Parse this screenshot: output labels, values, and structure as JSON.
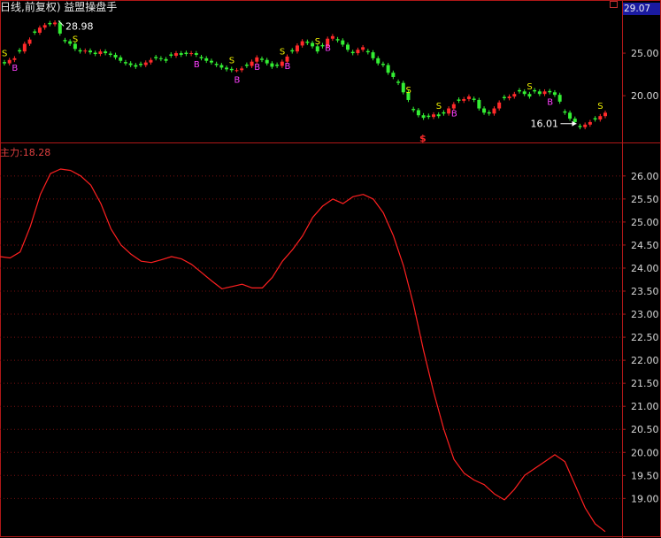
{
  "header": {
    "title": "日线,前复权) 益盟操盘手",
    "indicator_label": "主力:18.28",
    "last_price": "29.07"
  },
  "colors": {
    "background": "#000000",
    "frame": "#b01818",
    "grid": "#7a1010",
    "axis_text": "#d8d8d8",
    "indicator_line": "#ff2020",
    "candle_up": "#ff2a2a",
    "candle_down": "#33ee33",
    "signal_s": "#f0f000",
    "signal_b": "#ff40ff",
    "annotation": "#ffffff"
  },
  "chart_data": [
    {
      "type": "candlestick",
      "y_ticks": [
        "25.00",
        "20.00"
      ],
      "ylim": [
        14.5,
        30.0
      ],
      "annotations": {
        "high_label": "28.98",
        "low_label": "16.01",
        "marker_symbol": "$"
      },
      "closes": [
        23.8,
        24.2,
        24.4,
        25.2,
        26.1,
        26.6,
        27.4,
        28.0,
        28.3,
        28.4,
        28.6,
        27.3,
        26.4,
        26.1,
        25.5,
        25.2,
        25.3,
        25.1,
        24.9,
        25.2,
        25.0,
        24.8,
        24.5,
        24.1,
        23.8,
        23.6,
        23.4,
        23.6,
        23.9,
        24.2,
        24.4,
        24.3,
        24.1,
        24.7,
        25.0,
        24.8,
        24.9,
        25.0,
        24.8,
        24.4,
        24.1,
        23.9,
        23.6,
        23.3,
        23.1,
        23.0,
        23.0,
        23.2,
        23.5,
        24.0,
        24.5,
        24.2,
        23.8,
        23.4,
        23.5,
        24.0,
        24.6,
        25.2,
        25.9,
        26.4,
        26.2,
        25.8,
        25.2,
        25.8,
        26.7,
        27.0,
        26.5,
        26.0,
        25.4,
        25.0,
        25.4,
        25.7,
        25.1,
        24.4,
        23.8,
        23.6,
        22.7,
        22.2,
        21.5,
        20.4,
        19.5,
        18.3,
        17.7,
        17.4,
        17.5,
        17.8,
        17.6,
        17.9,
        18.5,
        19.0,
        19.4,
        19.6,
        19.9,
        19.5,
        18.5,
        18.0,
        17.9,
        18.5,
        19.2,
        19.7,
        19.9,
        20.2,
        20.5,
        20.2,
        19.9,
        20.5,
        20.2,
        20.5,
        20.4,
        20.1,
        19.3,
        18.0,
        17.3,
        16.9,
        16.3,
        16.6,
        16.9,
        17.2,
        17.6,
        18.0
      ]
    },
    {
      "type": "line",
      "name": "主力",
      "y_ticks": [
        "26.00",
        "25.50",
        "25.00",
        "24.50",
        "24.00",
        "23.50",
        "23.00",
        "22.50",
        "22.00",
        "21.50",
        "21.00",
        "20.50",
        "20.00",
        "19.50",
        "19.00"
      ],
      "ylim": [
        18.2,
        26.4
      ],
      "last_value": 18.28,
      "values": [
        24.25,
        24.22,
        24.35,
        24.9,
        25.6,
        26.05,
        26.15,
        26.12,
        26.0,
        25.8,
        25.4,
        24.85,
        24.5,
        24.3,
        24.15,
        24.12,
        24.18,
        24.25,
        24.2,
        24.08,
        23.9,
        23.72,
        23.55,
        23.6,
        23.65,
        23.57,
        23.57,
        23.8,
        24.15,
        24.4,
        24.7,
        25.1,
        25.35,
        25.5,
        25.4,
        25.55,
        25.6,
        25.5,
        25.2,
        24.7,
        24.05,
        23.2,
        22.2,
        21.3,
        20.5,
        19.85,
        19.55,
        19.4,
        19.3,
        19.1,
        18.97,
        19.2,
        19.5,
        19.65,
        19.8,
        19.95,
        19.8,
        19.3,
        18.8,
        18.45,
        18.28
      ]
    }
  ]
}
